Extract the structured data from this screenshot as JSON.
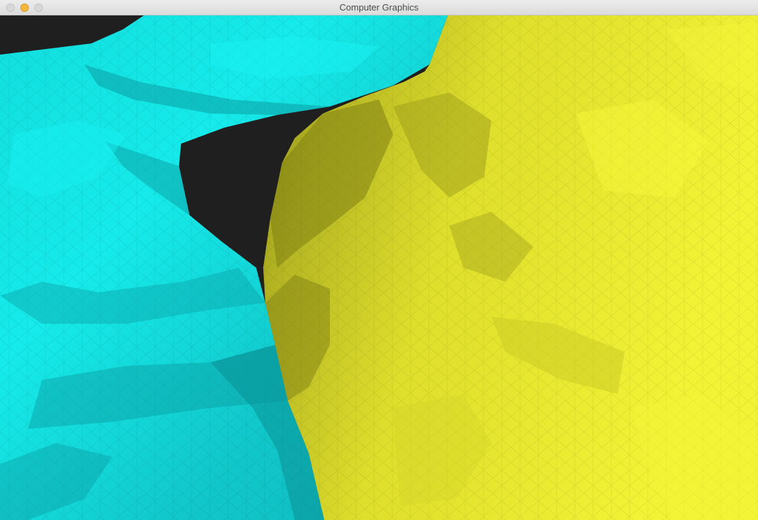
{
  "window": {
    "title": "Computer Graphics"
  },
  "scene": {
    "background_color": "#1f1f1f",
    "objects": [
      {
        "name": "cyan-mesh",
        "color": "#16e6e6",
        "shade_color": "#0a8f93"
      },
      {
        "name": "yellow-mesh",
        "color": "#eeee2e",
        "shade_color": "#8a8a14"
      }
    ]
  }
}
